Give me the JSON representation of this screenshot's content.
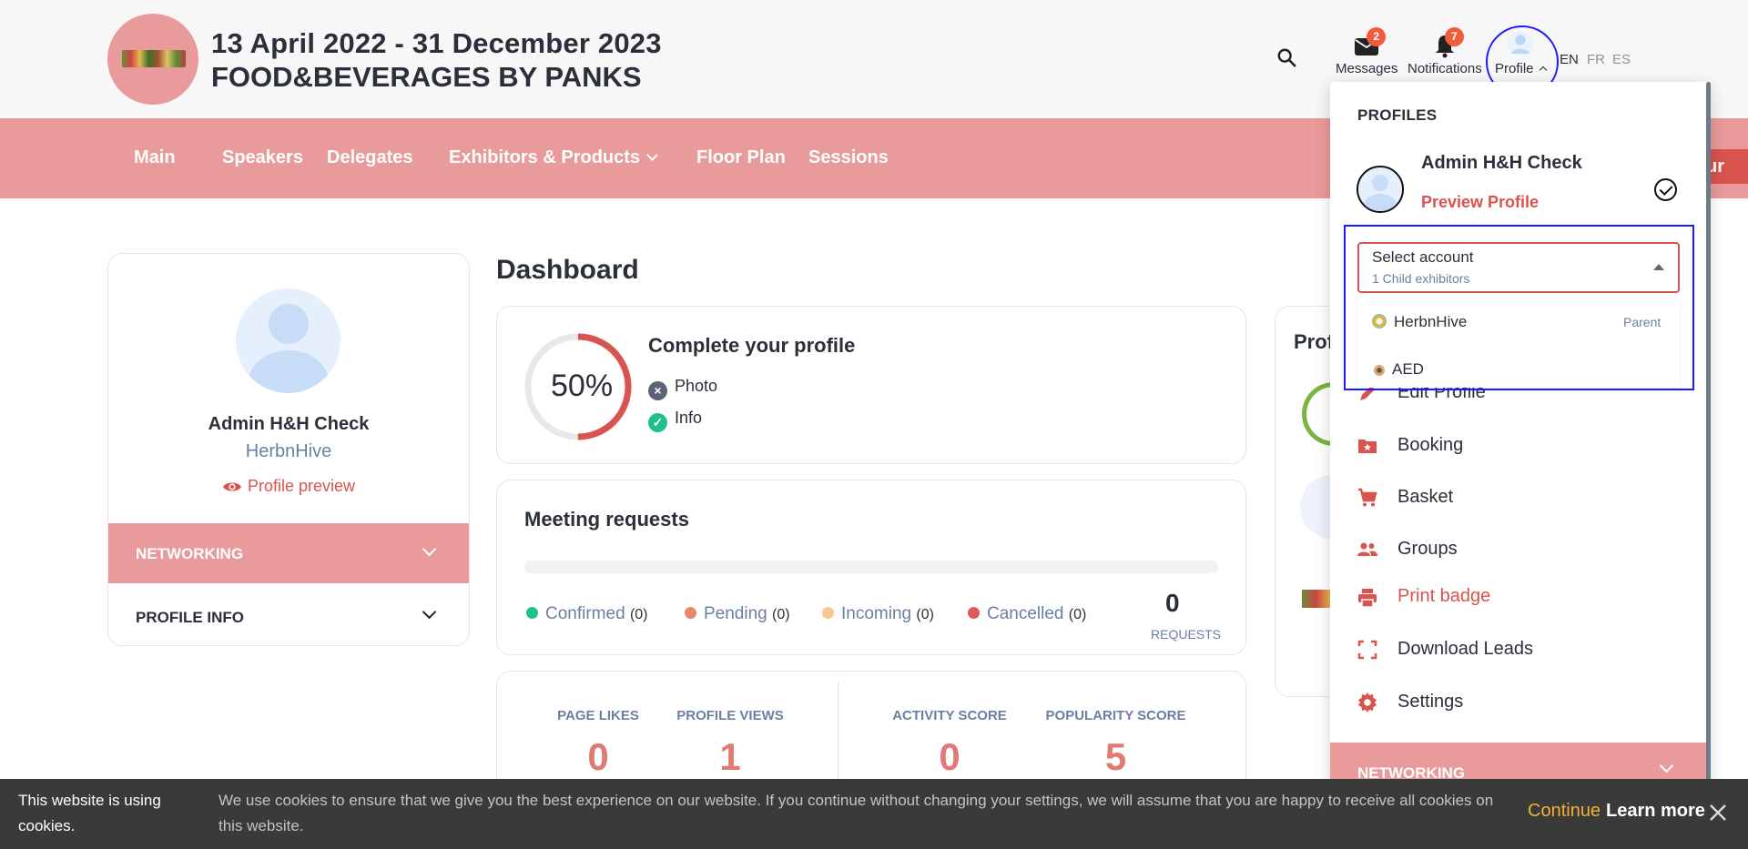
{
  "header": {
    "dates": "13 April 2022 - 31 December 2023",
    "event_name": "FOOD&BEVERAGES BY PANKS",
    "messages_label": "Messages",
    "messages_count": "2",
    "notifications_label": "Notifications",
    "notifications_count": "7",
    "profile_label": "Profile",
    "languages": [
      "EN",
      "FR",
      "ES"
    ]
  },
  "nav": {
    "items": [
      "Main",
      "Speakers",
      "Delegates",
      "Exhibitors & Products",
      "Floor Plan",
      "Sessions"
    ],
    "cta_partial": "ur"
  },
  "left_card": {
    "name": "Admin H&H Check",
    "company": "HerbnHive",
    "preview": "Profile preview",
    "networking": "NETWORKING",
    "profile_info": "PROFILE INFO"
  },
  "dashboard": {
    "title": "Dashboard",
    "complete_profile": {
      "progress_text": "50%",
      "progress": 0.5,
      "title": "Complete your profile",
      "items": [
        {
          "label": "Photo",
          "done": false
        },
        {
          "label": "Info",
          "done": true
        }
      ]
    },
    "meeting_requests": {
      "title": "Meeting requests",
      "statuses": [
        {
          "label": "Confirmed",
          "count": "(0)",
          "color": "#1fbf8f"
        },
        {
          "label": "Pending",
          "count": "(0)",
          "color": "#e8876a"
        },
        {
          "label": "Incoming",
          "count": "(0)",
          "color": "#f7c98d"
        },
        {
          "label": "Cancelled",
          "count": "(0)",
          "color": "#e05a5a"
        }
      ],
      "total": "0",
      "total_label": "REQUESTS"
    },
    "stats": [
      {
        "label": "PAGE LIKES",
        "value": "0"
      },
      {
        "label": "PROFILE VIEWS",
        "value": "1"
      },
      {
        "label": "ACTIVITY SCORE",
        "value": "0"
      },
      {
        "label": "POPULARITY SCORE",
        "value": "5"
      }
    ],
    "right_card_title": "Prof"
  },
  "profile_menu": {
    "heading": "PROFILES",
    "name": "Admin H&H Check",
    "preview": "Preview Profile",
    "select": {
      "label": "Select account",
      "sub": "1 Child exhibitors",
      "options": [
        {
          "label": "HerbnHive",
          "tag": "Parent"
        },
        {
          "label": "AED",
          "tag": ""
        }
      ]
    },
    "items": [
      "Edit Profile",
      "Booking",
      "Basket",
      "Groups",
      "Print badge",
      "Download Leads",
      "Settings"
    ],
    "networking": "NETWORKING"
  },
  "cookie": {
    "title": "This website is using cookies.",
    "text": "We use cookies to ensure that we give you the best experience on our website. If you continue without changing your settings, we will assume that you are happy to receive all cookies on this website.",
    "continue": "Continue",
    "learn_more": "Learn more"
  },
  "colors": {
    "accent_pink": "#e99a9a",
    "accent_red": "#d9534f",
    "highlight_blue": "#1a1aff"
  }
}
